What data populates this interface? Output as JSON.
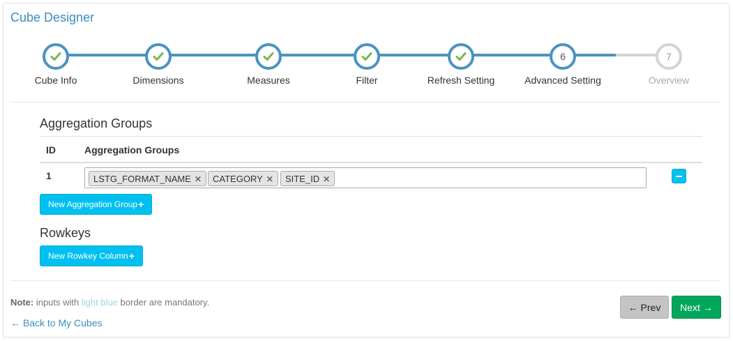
{
  "title": "Cube Designer",
  "colors": {
    "step_done": "#4a93c0",
    "check": "#74b84a",
    "pending": "#d3d3d3",
    "info": "#00c0ef",
    "success": "#00a65a"
  },
  "wizard": {
    "steps": [
      {
        "label": "Cube Info",
        "state": "done",
        "icon": "check-icon"
      },
      {
        "label": "Dimensions",
        "state": "done",
        "icon": "check-icon"
      },
      {
        "label": "Measures",
        "state": "done",
        "icon": "check-icon"
      },
      {
        "label": "Filter",
        "state": "done",
        "icon": "check-icon"
      },
      {
        "label": "Refresh Setting",
        "state": "done",
        "icon": "check-icon"
      },
      {
        "label": "Advanced Setting",
        "state": "current",
        "number": "6"
      },
      {
        "label": "Overview",
        "state": "pending",
        "number": "7"
      }
    ]
  },
  "aggregation": {
    "section_title": "Aggregation Groups",
    "columns": {
      "id": "ID",
      "groups": "Aggregation Groups"
    },
    "rows": [
      {
        "id": "1",
        "tags": [
          "LSTG_FORMAT_NAME",
          "CATEGORY",
          "SITE_ID"
        ]
      }
    ],
    "new_button_label": "New Aggregation Group",
    "new_button_icon": "+"
  },
  "rowkeys": {
    "section_title": "Rowkeys",
    "new_button_label": "New Rowkey Column",
    "new_button_icon": "+"
  },
  "footer": {
    "note_bold": "Note:",
    "note_text_1": " inputs with ",
    "note_highlight": "light blue",
    "note_text_2": " border are mandatory.",
    "back_icon": "←",
    "back_label": "Back to My Cubes",
    "prev_icon": "←",
    "prev_label": "Prev",
    "next_label": "Next",
    "next_icon": "→"
  }
}
